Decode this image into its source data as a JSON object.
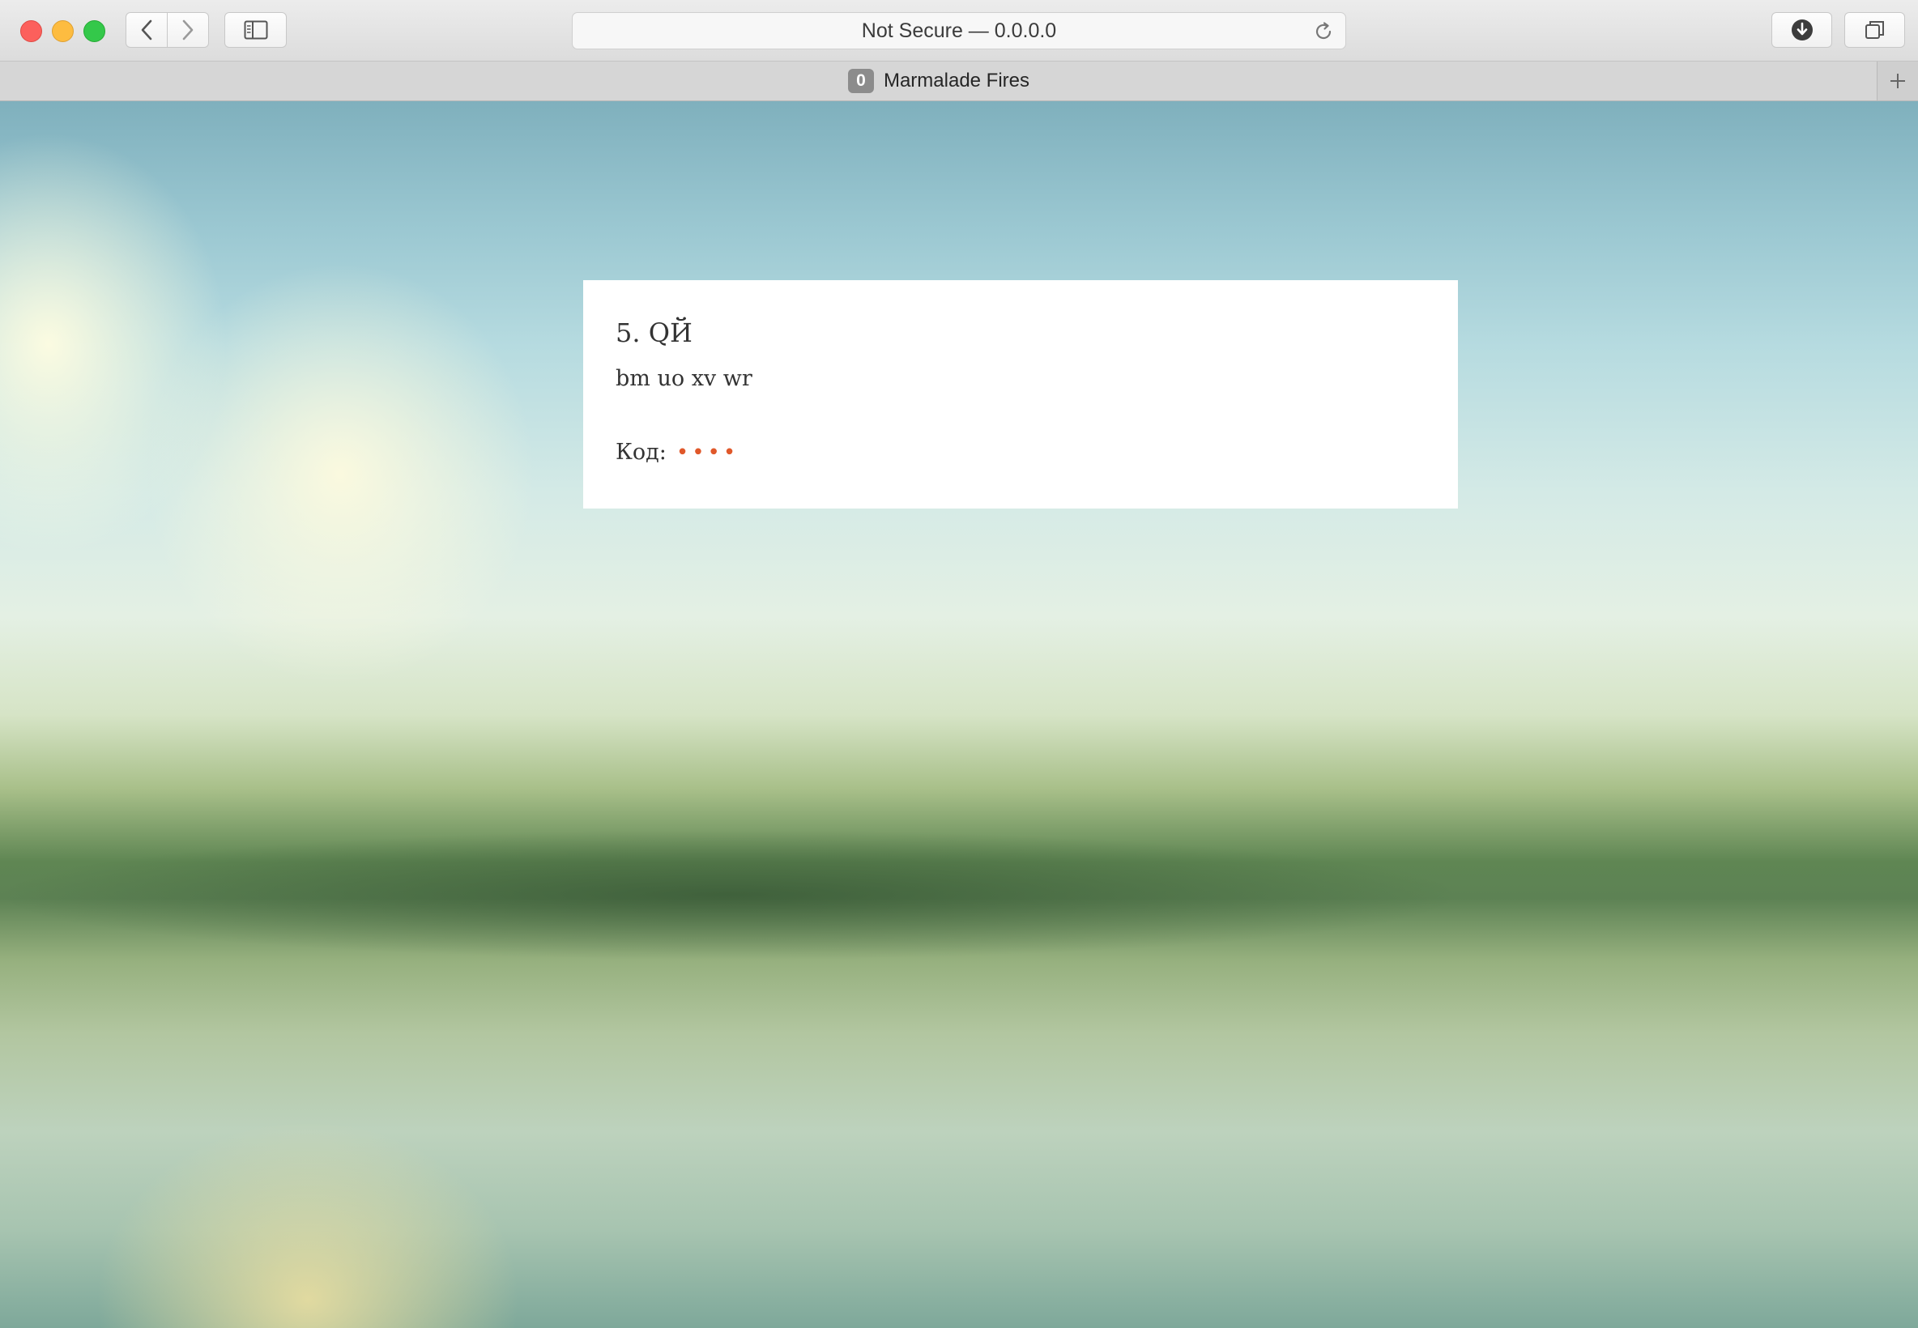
{
  "browser": {
    "url": "Not Secure — 0.0.0.0",
    "tab": {
      "badge": "0",
      "title": "Marmalade Fires"
    },
    "icons": [
      "back-icon",
      "forward-icon",
      "sidebar-icon",
      "reload-icon",
      "download-icon",
      "tabs-overview-icon",
      "plus-icon"
    ]
  },
  "card": {
    "title": "5. QЙ",
    "body": "bm uo xv wr",
    "code_label": "Код:",
    "code_value": "••••",
    "accent_color": "#e0582a"
  }
}
